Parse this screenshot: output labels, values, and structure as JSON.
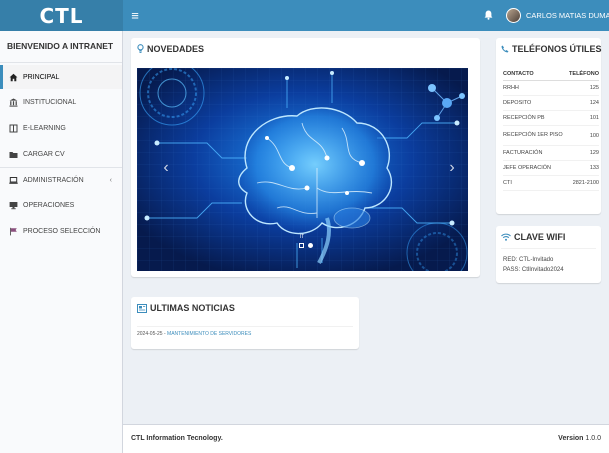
{
  "header": {
    "logo": "CTL",
    "menu_icon": "hamburger-icon",
    "bell_icon": "bell-icon",
    "user_name": "CARLOS MATIAS DUMAS"
  },
  "sidebar": {
    "title": "BIENVENIDO A INTRANET",
    "items": [
      {
        "label": "PRINCIPAL",
        "icon": "home-icon",
        "active": true
      },
      {
        "label": "INSTITUCIONAL",
        "icon": "bank-icon"
      },
      {
        "label": "E-LEARNING",
        "icon": "book-icon"
      },
      {
        "label": "CARGAR CV",
        "icon": "folder-icon"
      },
      {
        "label": "ADMINISTRACIÓN",
        "icon": "laptop-icon",
        "expandable": true
      },
      {
        "label": "OPERACIONES",
        "icon": "desktop-icon"
      },
      {
        "label": "PROCESO SELECCIÓN",
        "icon": "flag-icon"
      }
    ]
  },
  "novedades": {
    "title": "NOVEDADES",
    "icon": "lightbulb-icon",
    "caption": "IT"
  },
  "telefonos": {
    "title": "TELÉFONOS ÚTILES",
    "icon": "phone-icon",
    "col_contacto": "CONTACTO",
    "col_telefono": "TELÉFONO",
    "rows": [
      {
        "contacto": "RRHH",
        "telefono": "125"
      },
      {
        "contacto": "DEPOSITO",
        "telefono": "124"
      },
      {
        "contacto": "RECEPCIÓN PB",
        "telefono": "101"
      },
      {
        "contacto": "RECEPCIÓN 1ER PISO",
        "telefono": "100"
      },
      {
        "contacto": "FACTURACIÓN",
        "telefono": "129"
      },
      {
        "contacto": "JEFE OPERACIÓN",
        "telefono": "133"
      },
      {
        "contacto": "CTI",
        "telefono": "2821-2100"
      }
    ]
  },
  "wifi": {
    "title": "CLAVE WIFI",
    "icon": "wifi-icon",
    "red": "RED: CTL-Invitado",
    "pass": "PASS: CtlInvitado2024"
  },
  "noticias": {
    "title": "ULTIMAS NOTICIAS",
    "icon": "newspaper-icon",
    "date": "2024-05-25",
    "separator": " - ",
    "link": "MANTENIMIENTO DE SERVIDORES"
  },
  "footer": {
    "company": "CTL Information Tecnology.",
    "version_label": "Version",
    "version": "1.0.0"
  },
  "colors": {
    "header": "#3c8dbc",
    "logo_bg": "#367fa9",
    "accent": "#3c8dbc",
    "body_bg": "#ecf0f5"
  }
}
